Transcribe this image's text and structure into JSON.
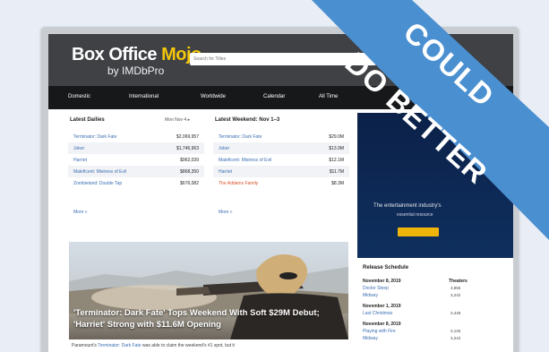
{
  "site": {
    "logo_main": "Box Office ",
    "logo_accent": "Mojo",
    "logo_sub": "by IMDbPro",
    "search_placeholder": "Search for Titles"
  },
  "nav": {
    "items": [
      "Domestic",
      "International",
      "Worldwide",
      "Calendar",
      "All Time"
    ]
  },
  "daily": {
    "title": "Latest Dailies",
    "subtitle": "Mon Nov 4 ▸",
    "rows": [
      {
        "title": "Terminator: Dark Fate",
        "value": "$2,069,957"
      },
      {
        "title": "Joker",
        "value": "$1,746,963"
      },
      {
        "title": "Harriet",
        "value": "$962,039"
      },
      {
        "title": "Maleficent: Mistress of Evil",
        "value": "$868,350"
      },
      {
        "title": "Zombieland: Double Tap",
        "value": "$676,082"
      }
    ],
    "more": "More »"
  },
  "weekend": {
    "title": "Latest Weekend: Nov 1–3",
    "rows": [
      {
        "title": "Terminator: Dark Fate",
        "value": "$29.0M"
      },
      {
        "title": "Joker",
        "value": "$13.9M"
      },
      {
        "title": "Maleficent: Mistress of Evil",
        "value": "$12.1M"
      },
      {
        "title": "Harriet",
        "value": "$11.7M"
      },
      {
        "title": "The Addams Family",
        "value": "$8.3M"
      }
    ],
    "more": "More »"
  },
  "ad": {
    "line1": "The entertainment industry's",
    "line2": "essential resource"
  },
  "release_schedule": {
    "title": "Release Schedule",
    "theaters_header": "Theaters",
    "groups": [
      {
        "date": "November 8, 2019",
        "movies": [
          {
            "title": "Doctor Sleep",
            "theaters": "3,855"
          },
          {
            "title": "Midway",
            "theaters": "3,242"
          }
        ]
      },
      {
        "date": "November 1, 2019",
        "movies": [
          {
            "title": "Last Christmas",
            "theaters": "3,448"
          }
        ]
      },
      {
        "date": "November 8, 2019",
        "movies": [
          {
            "title": "Playing with Fire",
            "theaters": "3,125"
          },
          {
            "title": "Midway",
            "theaters": "3,242"
          }
        ]
      }
    ]
  },
  "hero": {
    "headline": "'Terminator: Dark Fate' Tops Weekend With Soft $29M Debut; 'Harriet' Strong with $11.6M Opening",
    "caption_prefix": "Paramount's ",
    "caption_link": "Terminator: Dark Fate",
    "caption_suffix": " was able to claim the weekend's #1 spot, but it"
  },
  "banner": {
    "line1": "COULD",
    "line2": "DO BETTER",
    "color": "#4a8fd0"
  }
}
